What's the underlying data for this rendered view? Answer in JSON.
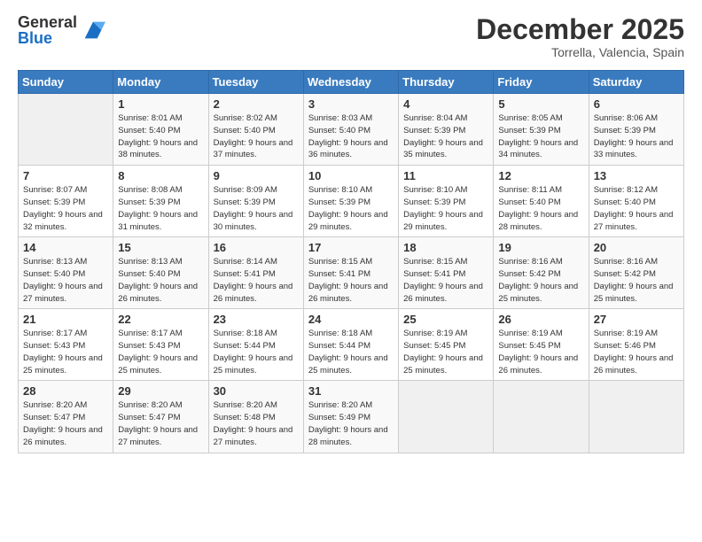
{
  "logo": {
    "general": "General",
    "blue": "Blue"
  },
  "header": {
    "month": "December 2025",
    "location": "Torrella, Valencia, Spain"
  },
  "weekdays": [
    "Sunday",
    "Monday",
    "Tuesday",
    "Wednesday",
    "Thursday",
    "Friday",
    "Saturday"
  ],
  "weeks": [
    [
      {
        "day": "",
        "sunrise": "",
        "sunset": "",
        "daylight": ""
      },
      {
        "day": "1",
        "sunrise": "Sunrise: 8:01 AM",
        "sunset": "Sunset: 5:40 PM",
        "daylight": "Daylight: 9 hours and 38 minutes."
      },
      {
        "day": "2",
        "sunrise": "Sunrise: 8:02 AM",
        "sunset": "Sunset: 5:40 PM",
        "daylight": "Daylight: 9 hours and 37 minutes."
      },
      {
        "day": "3",
        "sunrise": "Sunrise: 8:03 AM",
        "sunset": "Sunset: 5:40 PM",
        "daylight": "Daylight: 9 hours and 36 minutes."
      },
      {
        "day": "4",
        "sunrise": "Sunrise: 8:04 AM",
        "sunset": "Sunset: 5:39 PM",
        "daylight": "Daylight: 9 hours and 35 minutes."
      },
      {
        "day": "5",
        "sunrise": "Sunrise: 8:05 AM",
        "sunset": "Sunset: 5:39 PM",
        "daylight": "Daylight: 9 hours and 34 minutes."
      },
      {
        "day": "6",
        "sunrise": "Sunrise: 8:06 AM",
        "sunset": "Sunset: 5:39 PM",
        "daylight": "Daylight: 9 hours and 33 minutes."
      }
    ],
    [
      {
        "day": "7",
        "sunrise": "Sunrise: 8:07 AM",
        "sunset": "Sunset: 5:39 PM",
        "daylight": "Daylight: 9 hours and 32 minutes."
      },
      {
        "day": "8",
        "sunrise": "Sunrise: 8:08 AM",
        "sunset": "Sunset: 5:39 PM",
        "daylight": "Daylight: 9 hours and 31 minutes."
      },
      {
        "day": "9",
        "sunrise": "Sunrise: 8:09 AM",
        "sunset": "Sunset: 5:39 PM",
        "daylight": "Daylight: 9 hours and 30 minutes."
      },
      {
        "day": "10",
        "sunrise": "Sunrise: 8:10 AM",
        "sunset": "Sunset: 5:39 PM",
        "daylight": "Daylight: 9 hours and 29 minutes."
      },
      {
        "day": "11",
        "sunrise": "Sunrise: 8:10 AM",
        "sunset": "Sunset: 5:39 PM",
        "daylight": "Daylight: 9 hours and 29 minutes."
      },
      {
        "day": "12",
        "sunrise": "Sunrise: 8:11 AM",
        "sunset": "Sunset: 5:40 PM",
        "daylight": "Daylight: 9 hours and 28 minutes."
      },
      {
        "day": "13",
        "sunrise": "Sunrise: 8:12 AM",
        "sunset": "Sunset: 5:40 PM",
        "daylight": "Daylight: 9 hours and 27 minutes."
      }
    ],
    [
      {
        "day": "14",
        "sunrise": "Sunrise: 8:13 AM",
        "sunset": "Sunset: 5:40 PM",
        "daylight": "Daylight: 9 hours and 27 minutes."
      },
      {
        "day": "15",
        "sunrise": "Sunrise: 8:13 AM",
        "sunset": "Sunset: 5:40 PM",
        "daylight": "Daylight: 9 hours and 26 minutes."
      },
      {
        "day": "16",
        "sunrise": "Sunrise: 8:14 AM",
        "sunset": "Sunset: 5:41 PM",
        "daylight": "Daylight: 9 hours and 26 minutes."
      },
      {
        "day": "17",
        "sunrise": "Sunrise: 8:15 AM",
        "sunset": "Sunset: 5:41 PM",
        "daylight": "Daylight: 9 hours and 26 minutes."
      },
      {
        "day": "18",
        "sunrise": "Sunrise: 8:15 AM",
        "sunset": "Sunset: 5:41 PM",
        "daylight": "Daylight: 9 hours and 26 minutes."
      },
      {
        "day": "19",
        "sunrise": "Sunrise: 8:16 AM",
        "sunset": "Sunset: 5:42 PM",
        "daylight": "Daylight: 9 hours and 25 minutes."
      },
      {
        "day": "20",
        "sunrise": "Sunrise: 8:16 AM",
        "sunset": "Sunset: 5:42 PM",
        "daylight": "Daylight: 9 hours and 25 minutes."
      }
    ],
    [
      {
        "day": "21",
        "sunrise": "Sunrise: 8:17 AM",
        "sunset": "Sunset: 5:43 PM",
        "daylight": "Daylight: 9 hours and 25 minutes."
      },
      {
        "day": "22",
        "sunrise": "Sunrise: 8:17 AM",
        "sunset": "Sunset: 5:43 PM",
        "daylight": "Daylight: 9 hours and 25 minutes."
      },
      {
        "day": "23",
        "sunrise": "Sunrise: 8:18 AM",
        "sunset": "Sunset: 5:44 PM",
        "daylight": "Daylight: 9 hours and 25 minutes."
      },
      {
        "day": "24",
        "sunrise": "Sunrise: 8:18 AM",
        "sunset": "Sunset: 5:44 PM",
        "daylight": "Daylight: 9 hours and 25 minutes."
      },
      {
        "day": "25",
        "sunrise": "Sunrise: 8:19 AM",
        "sunset": "Sunset: 5:45 PM",
        "daylight": "Daylight: 9 hours and 25 minutes."
      },
      {
        "day": "26",
        "sunrise": "Sunrise: 8:19 AM",
        "sunset": "Sunset: 5:45 PM",
        "daylight": "Daylight: 9 hours and 26 minutes."
      },
      {
        "day": "27",
        "sunrise": "Sunrise: 8:19 AM",
        "sunset": "Sunset: 5:46 PM",
        "daylight": "Daylight: 9 hours and 26 minutes."
      }
    ],
    [
      {
        "day": "28",
        "sunrise": "Sunrise: 8:20 AM",
        "sunset": "Sunset: 5:47 PM",
        "daylight": "Daylight: 9 hours and 26 minutes."
      },
      {
        "day": "29",
        "sunrise": "Sunrise: 8:20 AM",
        "sunset": "Sunset: 5:47 PM",
        "daylight": "Daylight: 9 hours and 27 minutes."
      },
      {
        "day": "30",
        "sunrise": "Sunrise: 8:20 AM",
        "sunset": "Sunset: 5:48 PM",
        "daylight": "Daylight: 9 hours and 27 minutes."
      },
      {
        "day": "31",
        "sunrise": "Sunrise: 8:20 AM",
        "sunset": "Sunset: 5:49 PM",
        "daylight": "Daylight: 9 hours and 28 minutes."
      },
      {
        "day": "",
        "sunrise": "",
        "sunset": "",
        "daylight": ""
      },
      {
        "day": "",
        "sunrise": "",
        "sunset": "",
        "daylight": ""
      },
      {
        "day": "",
        "sunrise": "",
        "sunset": "",
        "daylight": ""
      }
    ]
  ]
}
